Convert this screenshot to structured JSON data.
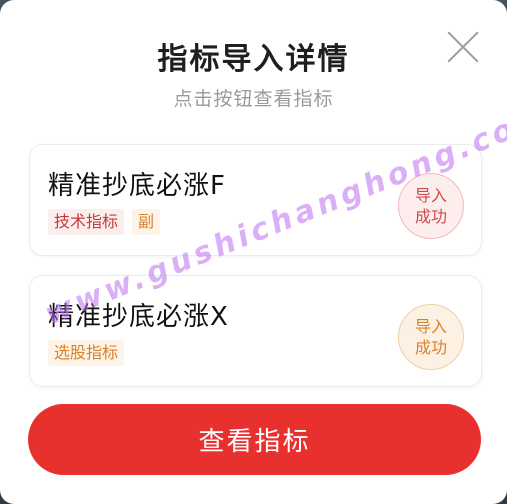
{
  "modal": {
    "title": "指标导入详情",
    "subtitle": "点击按钮查看指标"
  },
  "indicators": [
    {
      "name": "精准抄底必涨F",
      "tags": [
        "技术指标",
        "副"
      ],
      "status": "导入\n成功",
      "status_color": "#d24a4a"
    },
    {
      "name": "精准抄底必涨X",
      "tags": [
        "选股指标"
      ],
      "status": "导入\n成功",
      "status_color": "#d9822b"
    }
  ],
  "button": {
    "label": "查看指标",
    "color": "#e8302f"
  },
  "watermark": "www.gushichanghong.com",
  "icons": {
    "close": "close-icon"
  }
}
